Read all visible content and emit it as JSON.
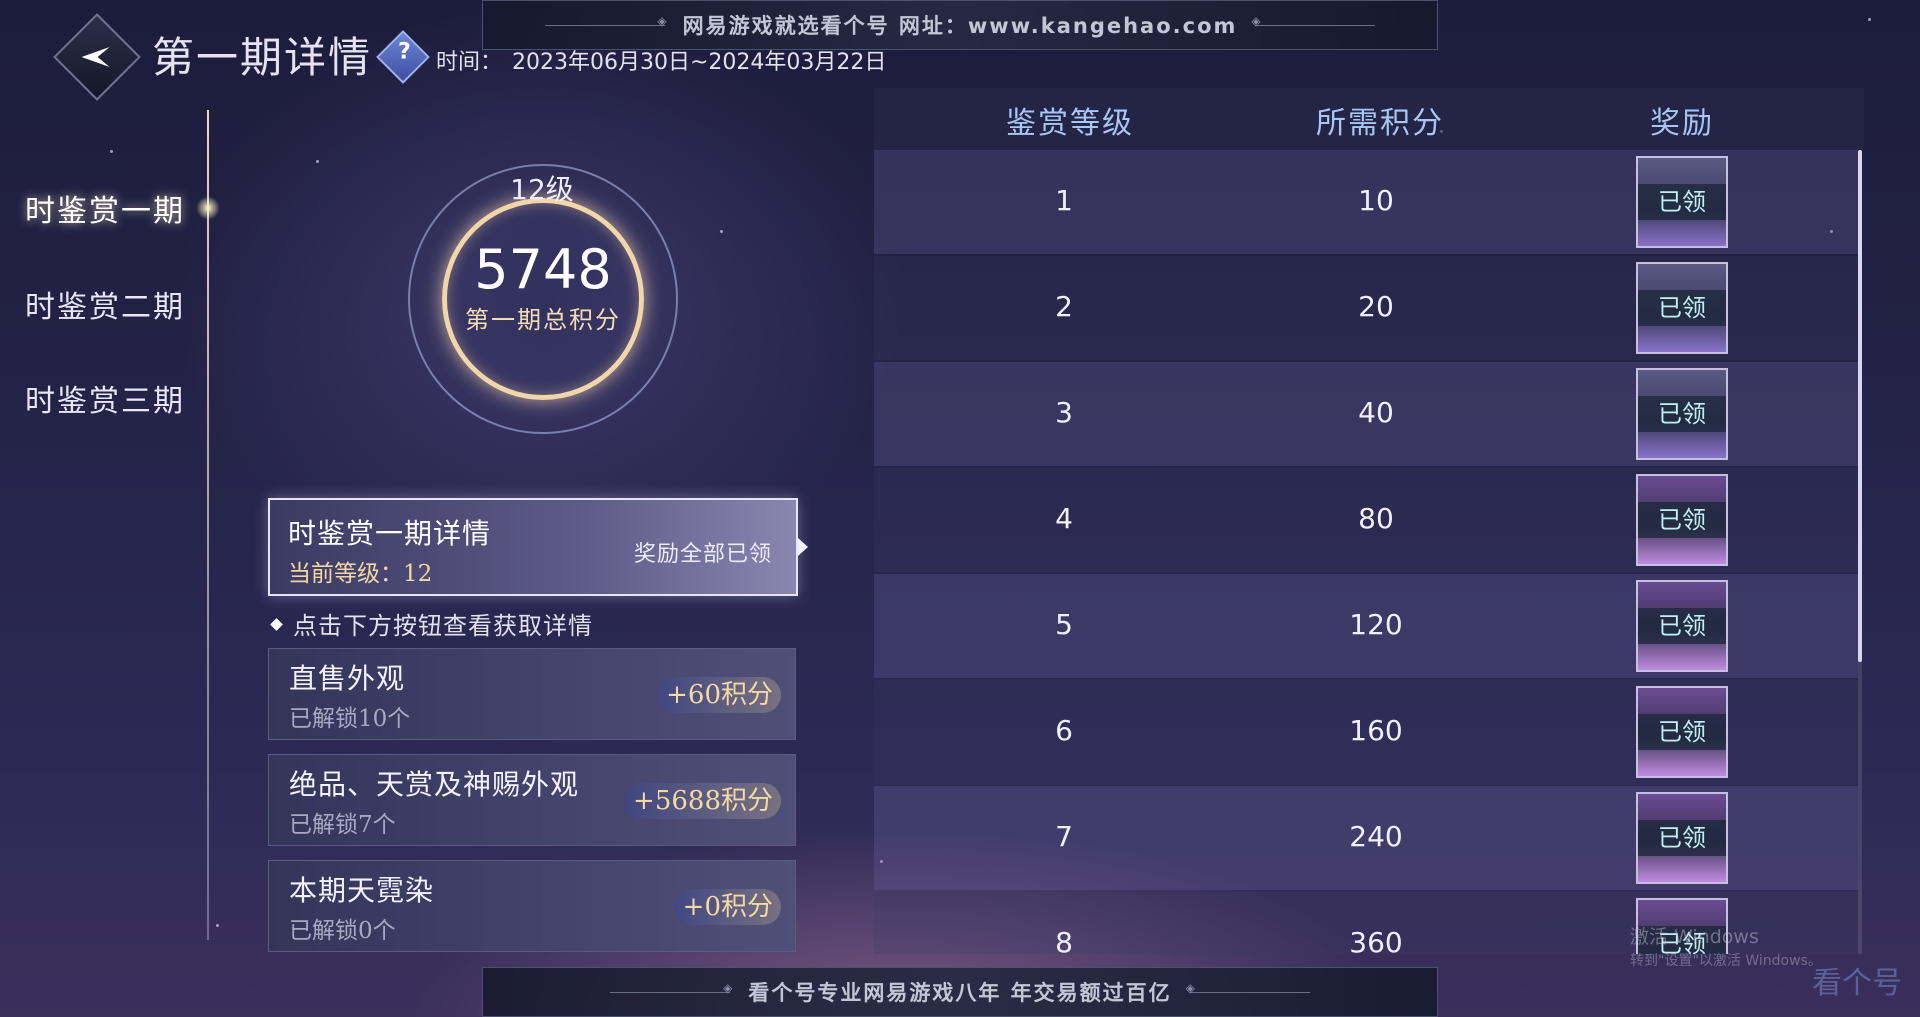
{
  "banner_top": "网易游戏就选看个号  网址：www.kangehao.com",
  "banner_bottom": "看个号专业网易游戏八年  年交易额过百亿",
  "header": {
    "title": "第一期详情",
    "help_symbol": "?",
    "time_label": "时间：",
    "time_range": "2023年06月30日~2024年03月22日"
  },
  "sidebar": {
    "items": [
      {
        "label": "时鉴赏一期"
      },
      {
        "label": "时鉴赏二期"
      },
      {
        "label": "时鉴赏三期"
      }
    ]
  },
  "badge": {
    "level": "12级",
    "score": "5748",
    "caption": "第一期总积分"
  },
  "period_card": {
    "title": "时鉴赏一期详情",
    "level": "当前等级：12",
    "status": "奖励全部已领"
  },
  "hint": "点击下方按钮查看获取详情",
  "sources": [
    {
      "title": "直售外观",
      "sub": "已解锁10个",
      "points": "+60积分"
    },
    {
      "title": "绝品、天赏及神赐外观",
      "sub": "已解锁7个",
      "points": "+5688积分"
    },
    {
      "title": "本期天霓染",
      "sub": "已解锁0个",
      "points": "+0积分"
    }
  ],
  "table": {
    "headers": [
      "鉴赏等级",
      "所需积分",
      "奖励"
    ],
    "rows": [
      {
        "level": "1",
        "points": "10",
        "reward": "已领"
      },
      {
        "level": "2",
        "points": "20",
        "reward": "已领"
      },
      {
        "level": "3",
        "points": "40",
        "reward": "已领"
      },
      {
        "level": "4",
        "points": "80",
        "reward": "已领"
      },
      {
        "level": "5",
        "points": "120",
        "reward": "已领"
      },
      {
        "level": "6",
        "points": "160",
        "reward": "已领"
      },
      {
        "level": "7",
        "points": "240",
        "reward": "已领"
      },
      {
        "level": "8",
        "points": "360",
        "reward": "已领"
      }
    ]
  },
  "activation": {
    "line1": "激活 Windows",
    "line2": "转到\"设置\"以激活 Windows。"
  },
  "logo_watermark": "看个号"
}
